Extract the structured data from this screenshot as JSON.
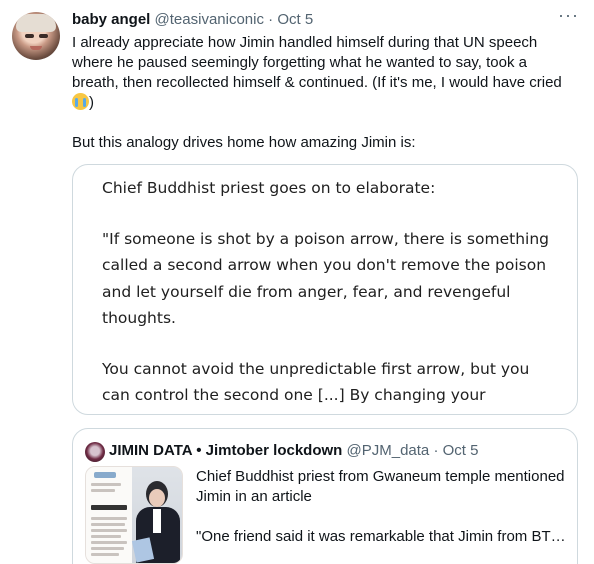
{
  "tweet": {
    "author": {
      "name": "baby angel",
      "handle": "@teasivaniconic",
      "separator": "·",
      "date": "Oct 5"
    },
    "more_icon": "···",
    "text_line1": "I already appreciate how Jimin handled himself during that UN speech where he paused seemingly forgetting what he wanted to say, took  a breath, then recollected himself & continued. (If it's me, I would have cried ",
    "text_after_emoji": ")",
    "emoji_name": "loudly-crying-face",
    "text_para2": "But this analogy drives home how amazing Jimin is:"
  },
  "image_card": {
    "line1": "Chief Buddhist priest goes on to elaborate:",
    "para2": "\"If someone is shot by a poison arrow, there is something called a second arrow when you don't remove the poison and let yourself die from anger, fear, and revengeful thoughts.",
    "para3": "You cannot avoid the unpredictable first arrow, but you can control the second one [...] By changing your thoughts, you can free yourself from the second arrow and become happy\""
  },
  "quote_tweet": {
    "name": "JIMIN DATA • Jimtober lockdown",
    "handle": "@PJM_data",
    "separator": "·",
    "date": "Oct 5",
    "text_line1": "Chief Buddhist priest from Gwaneum temple mentioned Jimin in an article",
    "text_line2": "\"One friend said it was remarkable that Jimin from BTS once forgot his words and stopped by calmly started ..."
  },
  "colors": {
    "text_primary": "#0f1419",
    "text_secondary": "#536471",
    "border": "#cfd9de"
  }
}
